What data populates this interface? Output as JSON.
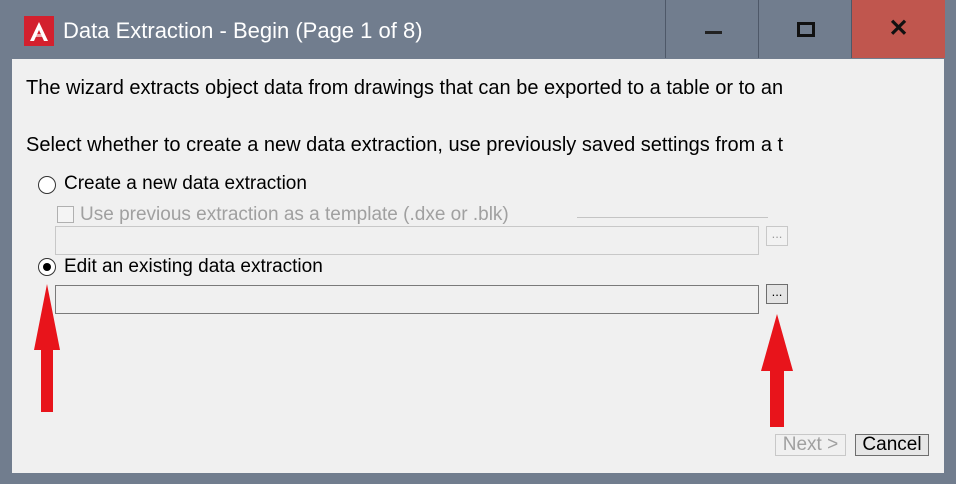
{
  "window": {
    "title": "Data Extraction - Begin (Page 1 of 8)",
    "controls": {
      "minimize": "minimize",
      "maximize": "maximize",
      "close": "close"
    },
    "colors": {
      "titlebar": "#717d8e",
      "close_button": "#c0564e",
      "client": "#f0f0f0",
      "app_icon": "#d3202e"
    }
  },
  "content": {
    "description_1": "The wizard extracts object data from drawings that can be exported to a table or to an",
    "description_2": "Select whether to create a new data extraction, use previously saved settings from a t",
    "options": {
      "create_new": {
        "label": "Create a new data extraction",
        "selected": false
      },
      "use_template": {
        "label": "Use previous extraction as a template (.dxe or .blk)",
        "checked": false,
        "enabled": false
      },
      "template_path": "",
      "template_browse": "...",
      "edit_existing": {
        "label": "Edit an existing data extraction",
        "selected": true
      },
      "existing_path": "",
      "existing_browse": "..."
    }
  },
  "footer": {
    "next_label": "Next >",
    "cancel_label": "Cancel"
  },
  "annotations": {
    "arrow_color": "#e8141b"
  }
}
